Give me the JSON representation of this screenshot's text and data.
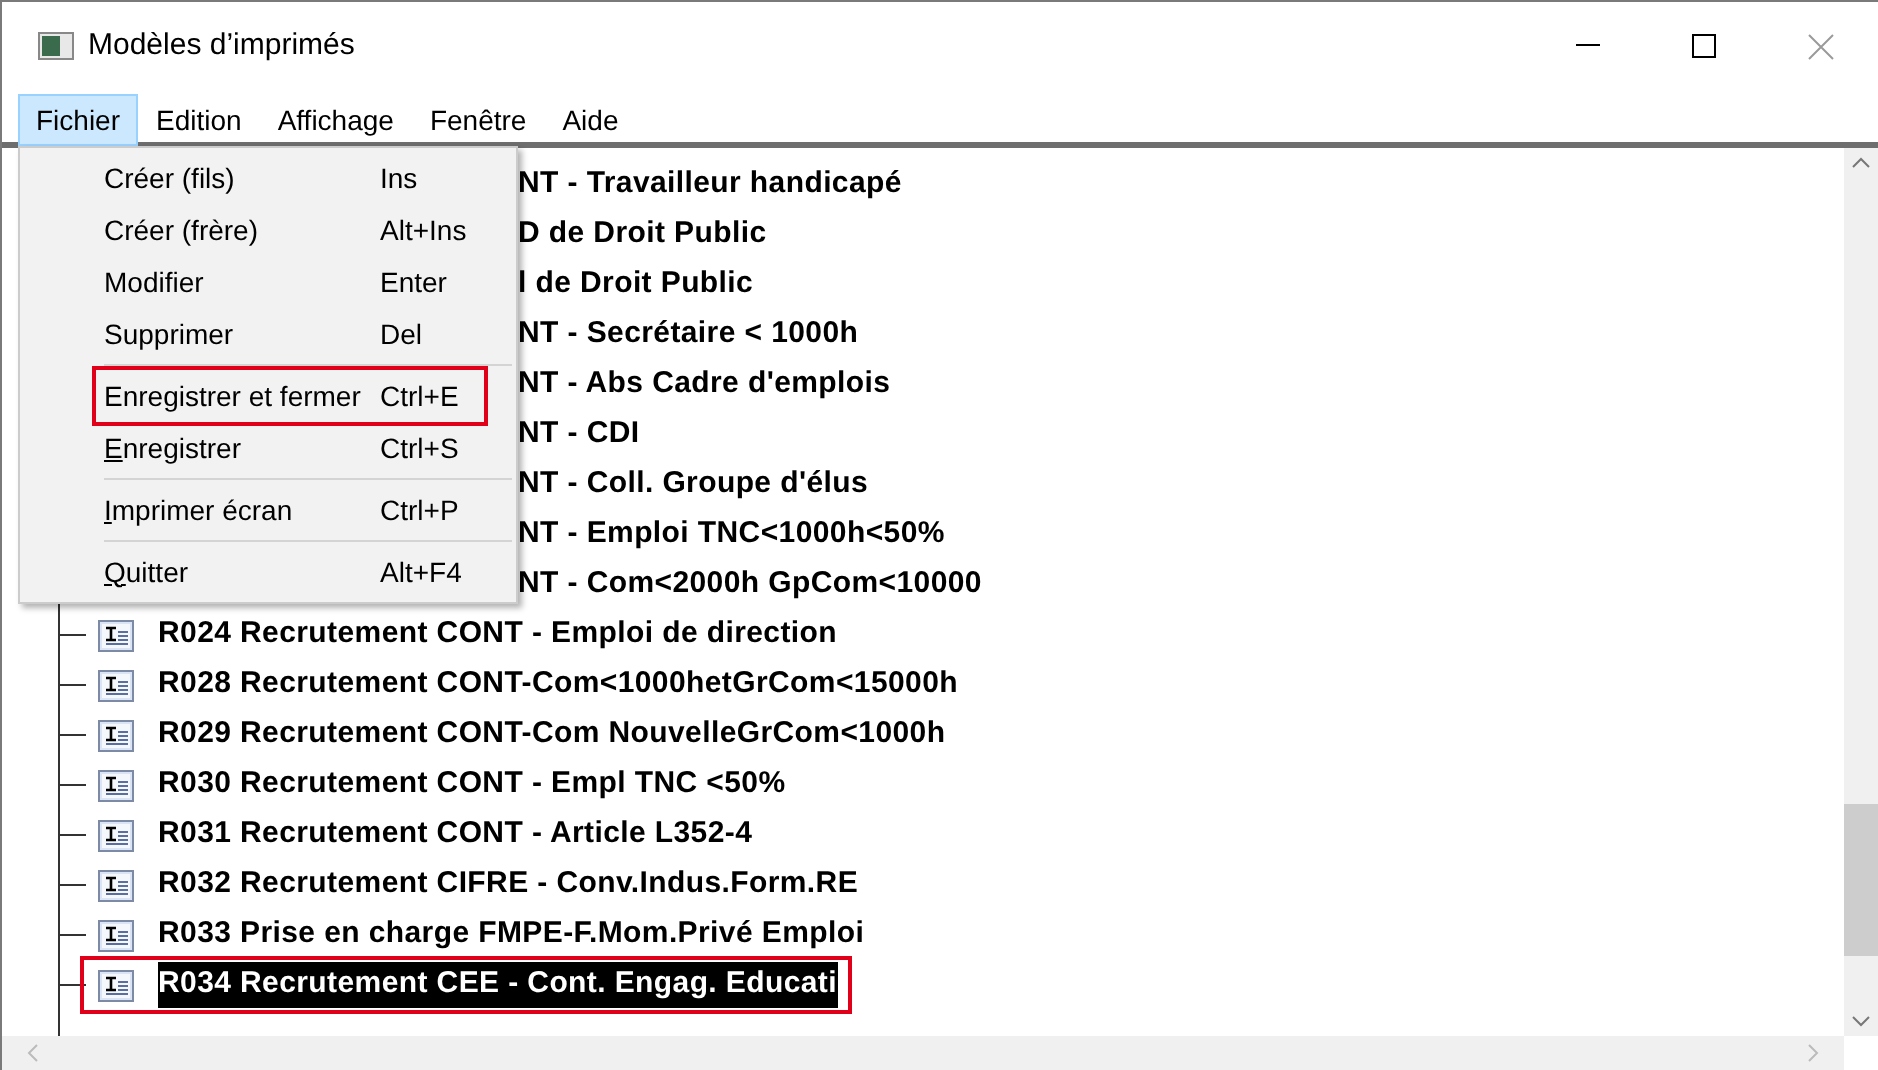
{
  "window": {
    "title": "Modèles d’imprimés"
  },
  "menu_bar": [
    {
      "label": "Fichier",
      "selected": true
    },
    {
      "label": "Edition",
      "selected": false
    },
    {
      "label": "Affichage",
      "selected": false
    },
    {
      "label": "Fenêtre",
      "selected": false
    },
    {
      "label": "Aide",
      "selected": false
    }
  ],
  "menu": {
    "groups": [
      [
        {
          "label": "Créer (fils)",
          "shortcut": "Ins",
          "mnemonic": false,
          "highlighted": false
        },
        {
          "label": "Créer (frère)",
          "shortcut": "Alt+Ins",
          "mnemonic": false,
          "highlighted": false
        },
        {
          "label": "Modifier",
          "shortcut": "Enter",
          "mnemonic": false,
          "highlighted": false
        },
        {
          "label": "Supprimer",
          "shortcut": "Del",
          "mnemonic": false,
          "highlighted": false
        }
      ],
      [
        {
          "label": "Enregistrer et fermer",
          "shortcut": "Ctrl+E",
          "mnemonic": false,
          "highlighted": true
        },
        {
          "label": "Enregistrer",
          "shortcut": "Ctrl+S",
          "mnemonic": true,
          "highlighted": false
        }
      ],
      [
        {
          "label": "Imprimer écran",
          "shortcut": "Ctrl+P",
          "mnemonic": true,
          "highlighted": false
        }
      ],
      [
        {
          "label": "Quitter",
          "shortcut": "Alt+F4",
          "mnemonic": true,
          "highlighted": false
        }
      ]
    ]
  },
  "tree": {
    "items": [
      {
        "kind": "covered",
        "label": "NT - Travailleur handicapé"
      },
      {
        "kind": "covered",
        "label": "D de Droit Public"
      },
      {
        "kind": "covered",
        "label": "l de Droit Public"
      },
      {
        "kind": "covered",
        "label": "NT - Secrétaire < 1000h"
      },
      {
        "kind": "covered",
        "label": "NT - Abs Cadre d'emplois"
      },
      {
        "kind": "covered",
        "label": "NT - CDI"
      },
      {
        "kind": "covered",
        "label": "NT - Coll. Groupe d'élus"
      },
      {
        "kind": "covered",
        "label": "NT - Emploi TNC<1000h<50%"
      },
      {
        "kind": "covered",
        "label": "NT - Com<2000h GpCom<10000"
      },
      {
        "kind": "full",
        "label": "R024 Recrutement CONT - Emploi de direction",
        "selected": false,
        "highlighted": false
      },
      {
        "kind": "full",
        "label": "R028 Recrutement CONT-Com<1000hetGrCom<15000h",
        "selected": false,
        "highlighted": false
      },
      {
        "kind": "full",
        "label": "R029 Recrutement CONT-Com NouvelleGrCom<1000h",
        "selected": false,
        "highlighted": false
      },
      {
        "kind": "full",
        "label": "R030 Recrutement CONT - Empl TNC <50%",
        "selected": false,
        "highlighted": false
      },
      {
        "kind": "full",
        "label": "R031 Recrutement CONT - Article L352-4",
        "selected": false,
        "highlighted": false
      },
      {
        "kind": "full",
        "label": "R032 Recrutement CIFRE - Conv.Indus.Form.RE",
        "selected": false,
        "highlighted": false
      },
      {
        "kind": "full",
        "label": "R033 Prise en charge FMPE-F.Mom.Privé Emploi",
        "selected": false,
        "highlighted": false
      },
      {
        "kind": "full",
        "label": "R034 Recrutement CEE - Cont. Engag. Educati",
        "selected": true,
        "highlighted": true
      }
    ]
  }
}
